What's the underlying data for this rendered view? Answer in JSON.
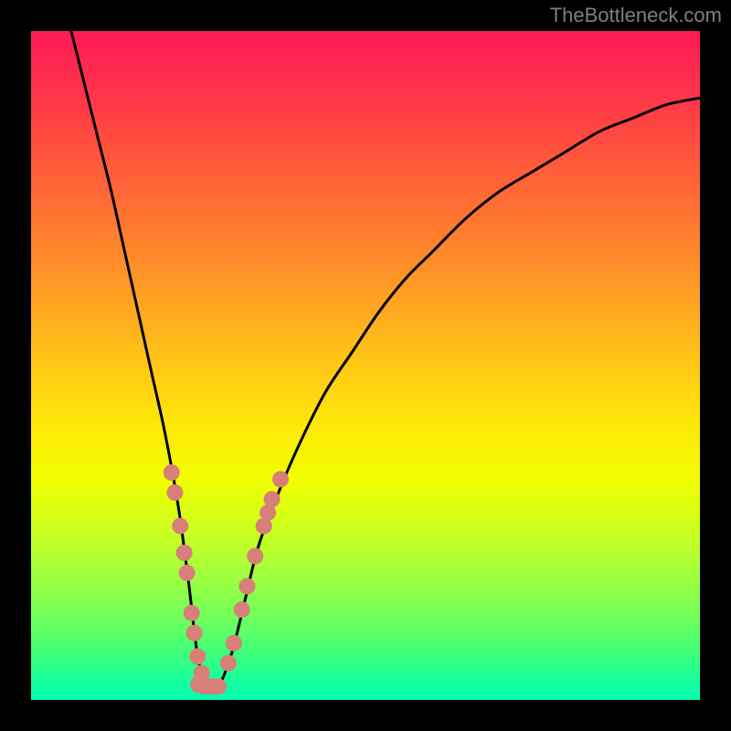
{
  "watermark": "TheBottleneck.com",
  "chart_data": {
    "type": "line",
    "title": "",
    "xlabel": "",
    "ylabel": "",
    "xlim": [
      0,
      100
    ],
    "ylim": [
      0,
      100
    ],
    "grid": false,
    "series": [
      {
        "name": "bottleneck-curve",
        "x": [
          6,
          8,
          10,
          12,
          14,
          16,
          18,
          20,
          22,
          23.5,
          25,
          26.5,
          28,
          30,
          32,
          34,
          37,
          40,
          44,
          48,
          52,
          56,
          60,
          65,
          70,
          75,
          80,
          85,
          90,
          95,
          100
        ],
        "y": [
          100,
          92,
          84,
          76,
          67,
          58,
          49,
          40,
          29,
          18,
          6,
          2,
          2,
          7,
          15,
          23,
          31,
          38,
          46,
          52,
          58,
          63,
          67,
          72,
          76,
          79,
          82,
          85,
          87,
          89,
          90
        ]
      }
    ],
    "markers": [
      {
        "name": "marker-clusters",
        "color": "#d77f78",
        "points": [
          {
            "x": 21.0,
            "y": 34.0
          },
          {
            "x": 21.5,
            "y": 31.0
          },
          {
            "x": 22.3,
            "y": 26.0
          },
          {
            "x": 22.9,
            "y": 22.0
          },
          {
            "x": 23.3,
            "y": 19.0
          },
          {
            "x": 24.0,
            "y": 13.0
          },
          {
            "x": 24.4,
            "y": 10.0
          },
          {
            "x": 24.9,
            "y": 6.5
          },
          {
            "x": 25.5,
            "y": 4.0
          },
          {
            "x": 25.0,
            "y": 2.3
          },
          {
            "x": 26.0,
            "y": 2.0
          },
          {
            "x": 27.0,
            "y": 2.0
          },
          {
            "x": 28.0,
            "y": 2.0
          },
          {
            "x": 29.5,
            "y": 5.5
          },
          {
            "x": 30.3,
            "y": 8.5
          },
          {
            "x": 31.5,
            "y": 13.5
          },
          {
            "x": 32.3,
            "y": 17.0
          },
          {
            "x": 33.5,
            "y": 21.5
          },
          {
            "x": 34.8,
            "y": 26.0
          },
          {
            "x": 35.4,
            "y": 28.0
          },
          {
            "x": 36.0,
            "y": 30.0
          },
          {
            "x": 37.3,
            "y": 33.0
          }
        ]
      }
    ]
  }
}
